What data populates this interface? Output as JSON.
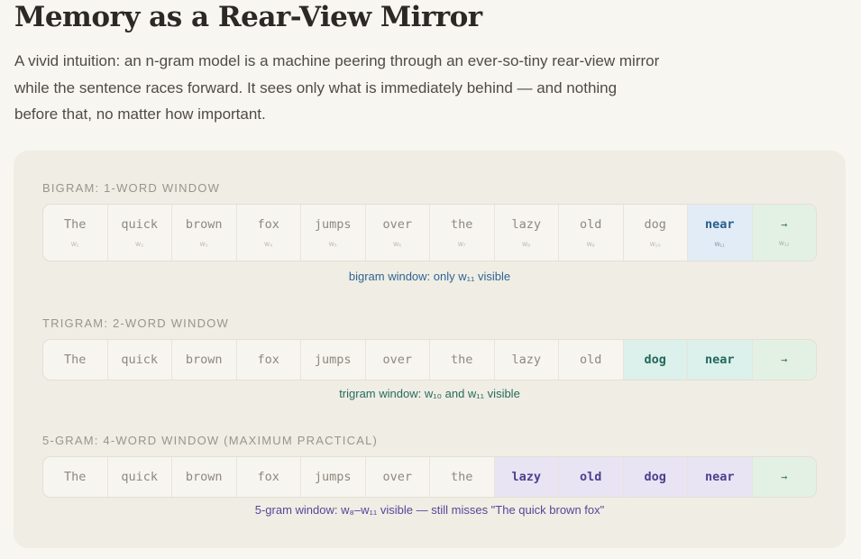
{
  "title": "Memory as a Rear-View Mirror",
  "intro": "A vivid intuition: an n-gram model is a machine peering through an ever-so-tiny rear-view mirror while the sentence races forward. It sees only what is immediately behind — and nothing before that, no matter how important.",
  "colors": {
    "bigram_highlight": "#e2ecf6",
    "trigram_highlight": "#dcf0ec",
    "fivegram_highlight": "#e8e4f4",
    "next_token": "#e3f1e5"
  },
  "sections": [
    {
      "label": "BIGRAM: 1-WORD WINDOW",
      "caption": "bigram window: only w₁₁ visible",
      "tokens": [
        {
          "word": "The",
          "sub": "w₁"
        },
        {
          "word": "quick",
          "sub": "w₂"
        },
        {
          "word": "brown",
          "sub": "w₃"
        },
        {
          "word": "fox",
          "sub": "w₄"
        },
        {
          "word": "jumps",
          "sub": "w₅"
        },
        {
          "word": "over",
          "sub": "w₆"
        },
        {
          "word": "the",
          "sub": "w₇"
        },
        {
          "word": "lazy",
          "sub": "w₈"
        },
        {
          "word": "old",
          "sub": "w₉"
        },
        {
          "word": "dog",
          "sub": "w₁₀"
        },
        {
          "word": "near",
          "sub": "w₁₁"
        },
        {
          "word": "→",
          "sub": "w₁₂"
        }
      ]
    },
    {
      "label": "TRIGRAM: 2-WORD WINDOW",
      "caption": "trigram window: w₁₀ and w₁₁ visible",
      "tokens": [
        {
          "word": "The"
        },
        {
          "word": "quick"
        },
        {
          "word": "brown"
        },
        {
          "word": "fox"
        },
        {
          "word": "jumps"
        },
        {
          "word": "over"
        },
        {
          "word": "the"
        },
        {
          "word": "lazy"
        },
        {
          "word": "old"
        },
        {
          "word": "dog"
        },
        {
          "word": "near"
        },
        {
          "word": "→"
        }
      ]
    },
    {
      "label": "5-GRAM: 4-WORD WINDOW (MAXIMUM PRACTICAL)",
      "caption": "5-gram window: w₈–w₁₁ visible — still misses \"The quick brown fox\"",
      "tokens": [
        {
          "word": "The"
        },
        {
          "word": "quick"
        },
        {
          "word": "brown"
        },
        {
          "word": "fox"
        },
        {
          "word": "jumps"
        },
        {
          "word": "over"
        },
        {
          "word": "the"
        },
        {
          "word": "lazy"
        },
        {
          "word": "old"
        },
        {
          "word": "dog"
        },
        {
          "word": "near"
        },
        {
          "word": "→"
        }
      ]
    }
  ]
}
